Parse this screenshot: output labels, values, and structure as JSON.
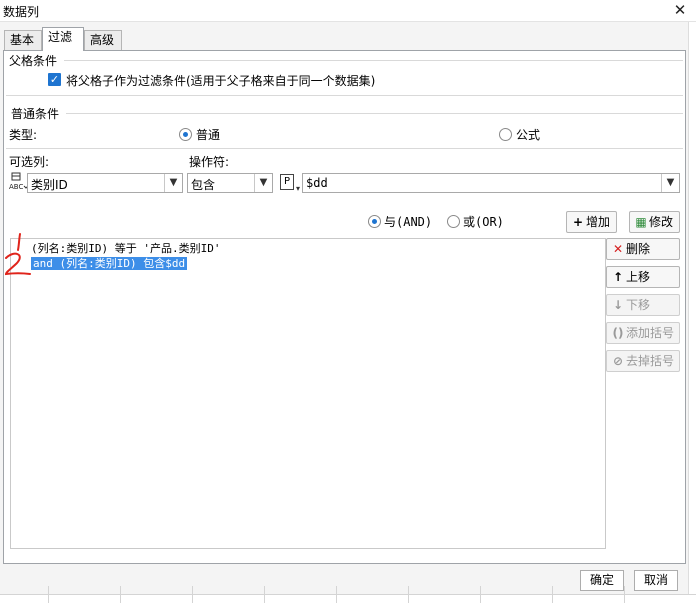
{
  "window": {
    "title": "数据列",
    "close_glyph": "✕"
  },
  "tabs": [
    "基本",
    "过滤",
    "高级"
  ],
  "parent": {
    "section_title": "父格条件",
    "checkbox_label": "将父格子作为过滤条件(适用于父子格来自于同一个数据集)",
    "checked": true
  },
  "normal": {
    "section_title": "普通条件",
    "type_label": "类型:",
    "type_options": [
      "普通",
      "公式"
    ],
    "selected_type": "普通",
    "column_label": "可选列:",
    "column_value": "类别ID",
    "operator_label": "操作符:",
    "operator_value": "包含",
    "param_badge": "P",
    "value_text": "$dd"
  },
  "logic": {
    "and_label": "与(AND)",
    "or_label": "或(OR)",
    "selected": "and"
  },
  "actions": {
    "add": "增加",
    "modify": "修改"
  },
  "conditions": [
    {
      "text": "(列名:类别ID) 等于 '产品.类别ID'",
      "selected": false
    },
    {
      "text": "and (列名:类别ID) 包含$dd",
      "selected": true
    }
  ],
  "side_buttons": [
    {
      "label": "删除",
      "icon": "delete-x-icon",
      "enabled": true
    },
    {
      "label": "上移",
      "icon": "arrow-up-icon",
      "enabled": true
    },
    {
      "label": "下移",
      "icon": "arrow-down-icon",
      "enabled": false
    },
    {
      "label": "添加括号",
      "icon": "add-bracket-icon",
      "enabled": false
    },
    {
      "label": "去掉括号",
      "icon": "remove-bracket-icon",
      "enabled": false
    }
  ],
  "footer": {
    "ok": "确定",
    "cancel": "取消"
  },
  "annotations": [
    "1",
    "2"
  ],
  "colors": {
    "accent": "#1e74d0",
    "selection": "#3d8ee8",
    "annotation": "#e0241b"
  }
}
